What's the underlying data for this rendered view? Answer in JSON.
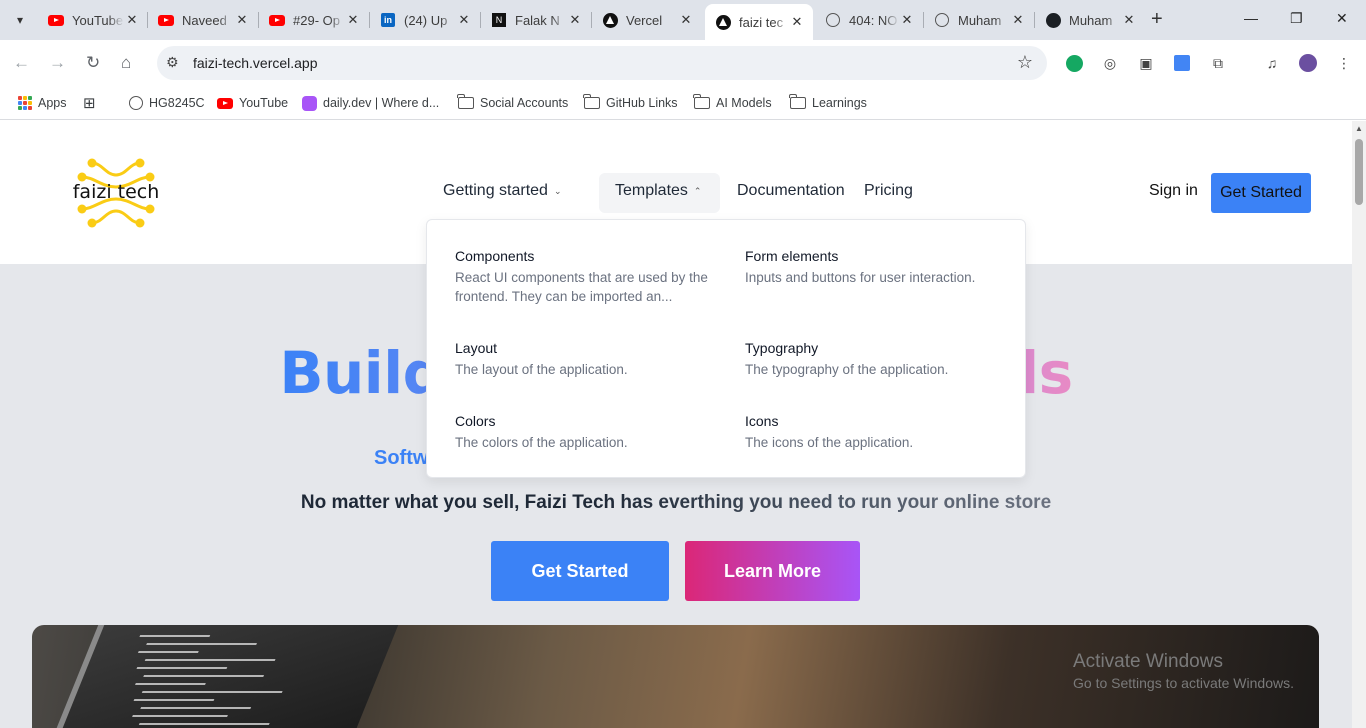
{
  "browser": {
    "tabs": [
      {
        "title": "YouTube",
        "icon": "youtube-icon"
      },
      {
        "title": "Naveed",
        "icon": "youtube-icon"
      },
      {
        "title": "#29- Op",
        "icon": "youtube-icon"
      },
      {
        "title": "(24) Up",
        "icon": "linkedin-icon"
      },
      {
        "title": "Falak N",
        "icon": "nextjs-icon"
      },
      {
        "title": "Vercel",
        "icon": "vercel-icon"
      },
      {
        "title": "faizi tec",
        "icon": "vercel-icon"
      },
      {
        "title": "404: NO",
        "icon": "globe-icon"
      },
      {
        "title": "Muham",
        "icon": "globe-icon"
      },
      {
        "title": "Muham",
        "icon": "github-icon"
      }
    ],
    "active_tab_index": 6,
    "url": "faizi-tech.vercel.app",
    "bookmarks": [
      {
        "label": "Apps",
        "icon": "apps-icon"
      },
      {
        "label": "",
        "icon": "grid-icon"
      },
      {
        "label": "HG8245C",
        "icon": "globe-icon"
      },
      {
        "label": "YouTube",
        "icon": "youtube-icon"
      },
      {
        "label": "daily.dev | Where d...",
        "icon": "dailydev-icon"
      },
      {
        "label": "Social Accounts",
        "icon": "folder-icon"
      },
      {
        "label": "GitHub Links",
        "icon": "folder-icon"
      },
      {
        "label": "AI Models",
        "icon": "folder-icon"
      },
      {
        "label": "Learnings",
        "icon": "folder-icon"
      }
    ]
  },
  "site": {
    "logo_text": "faizi tech",
    "nav": {
      "getting_started": "Getting started",
      "templates": "Templates",
      "documentation": "Documentation",
      "pricing": "Pricing",
      "sign_in": "Sign in",
      "get_started": "Get Started"
    },
    "dropdown": [
      {
        "title": "Components",
        "desc": "React UI components that are used by the frontend. They can be imported an..."
      },
      {
        "title": "Form elements",
        "desc": "Inputs and buttons for user interaction."
      },
      {
        "title": "Layout",
        "desc": "The layout of the application."
      },
      {
        "title": "Typography",
        "desc": "The typography of the application."
      },
      {
        "title": "Colors",
        "desc": "The colors of the application."
      },
      {
        "title": "Icons",
        "desc": "The icons of the application."
      }
    ],
    "hero": {
      "title": "Build a brand in seconds",
      "subtitle": "Softw",
      "description": "No matter what you sell, Faizi Tech has everthing you need to run your online store",
      "primary_button": "Get Started",
      "secondary_button": "Learn More"
    }
  },
  "watermark": {
    "line1": "Activate Windows",
    "line2": "Go to Settings to activate Windows."
  },
  "colors": {
    "accent": "#3b82f6",
    "pink": "#db2777",
    "purple": "#a855f7",
    "logo_yellow": "#facc15"
  }
}
